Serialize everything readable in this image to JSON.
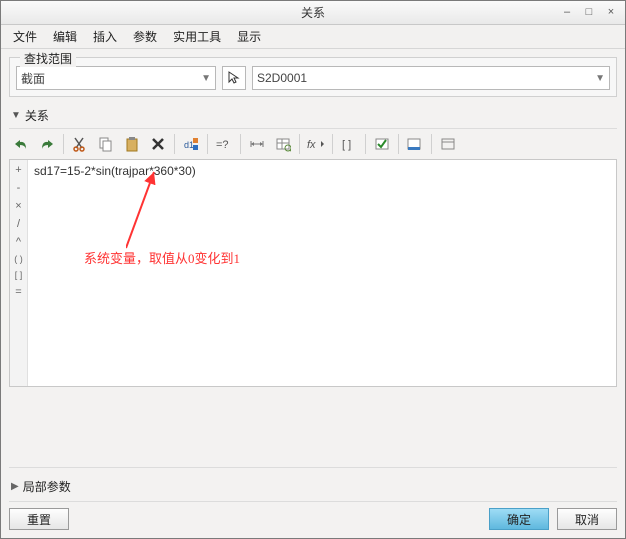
{
  "window": {
    "title": "关系"
  },
  "menubar": {
    "items": [
      "文件",
      "编辑",
      "插入",
      "参数",
      "实用工具",
      "显示"
    ]
  },
  "search_panel": {
    "legend": "查找范围",
    "left_combo": "截面",
    "right_combo": "S2D0001"
  },
  "relation_section": {
    "title": "关系"
  },
  "gutter": [
    "+",
    "-",
    "×",
    "/",
    "^",
    "( )",
    "[ ]",
    "="
  ],
  "editor": {
    "line1": "sd17=15-2*sin(trajpar*360*30)",
    "annotation": "系统变量，取值从0变化到1"
  },
  "local_params_section": {
    "title": "局部参数"
  },
  "buttons": {
    "reset": "重置",
    "ok": "确定",
    "cancel": "取消"
  }
}
